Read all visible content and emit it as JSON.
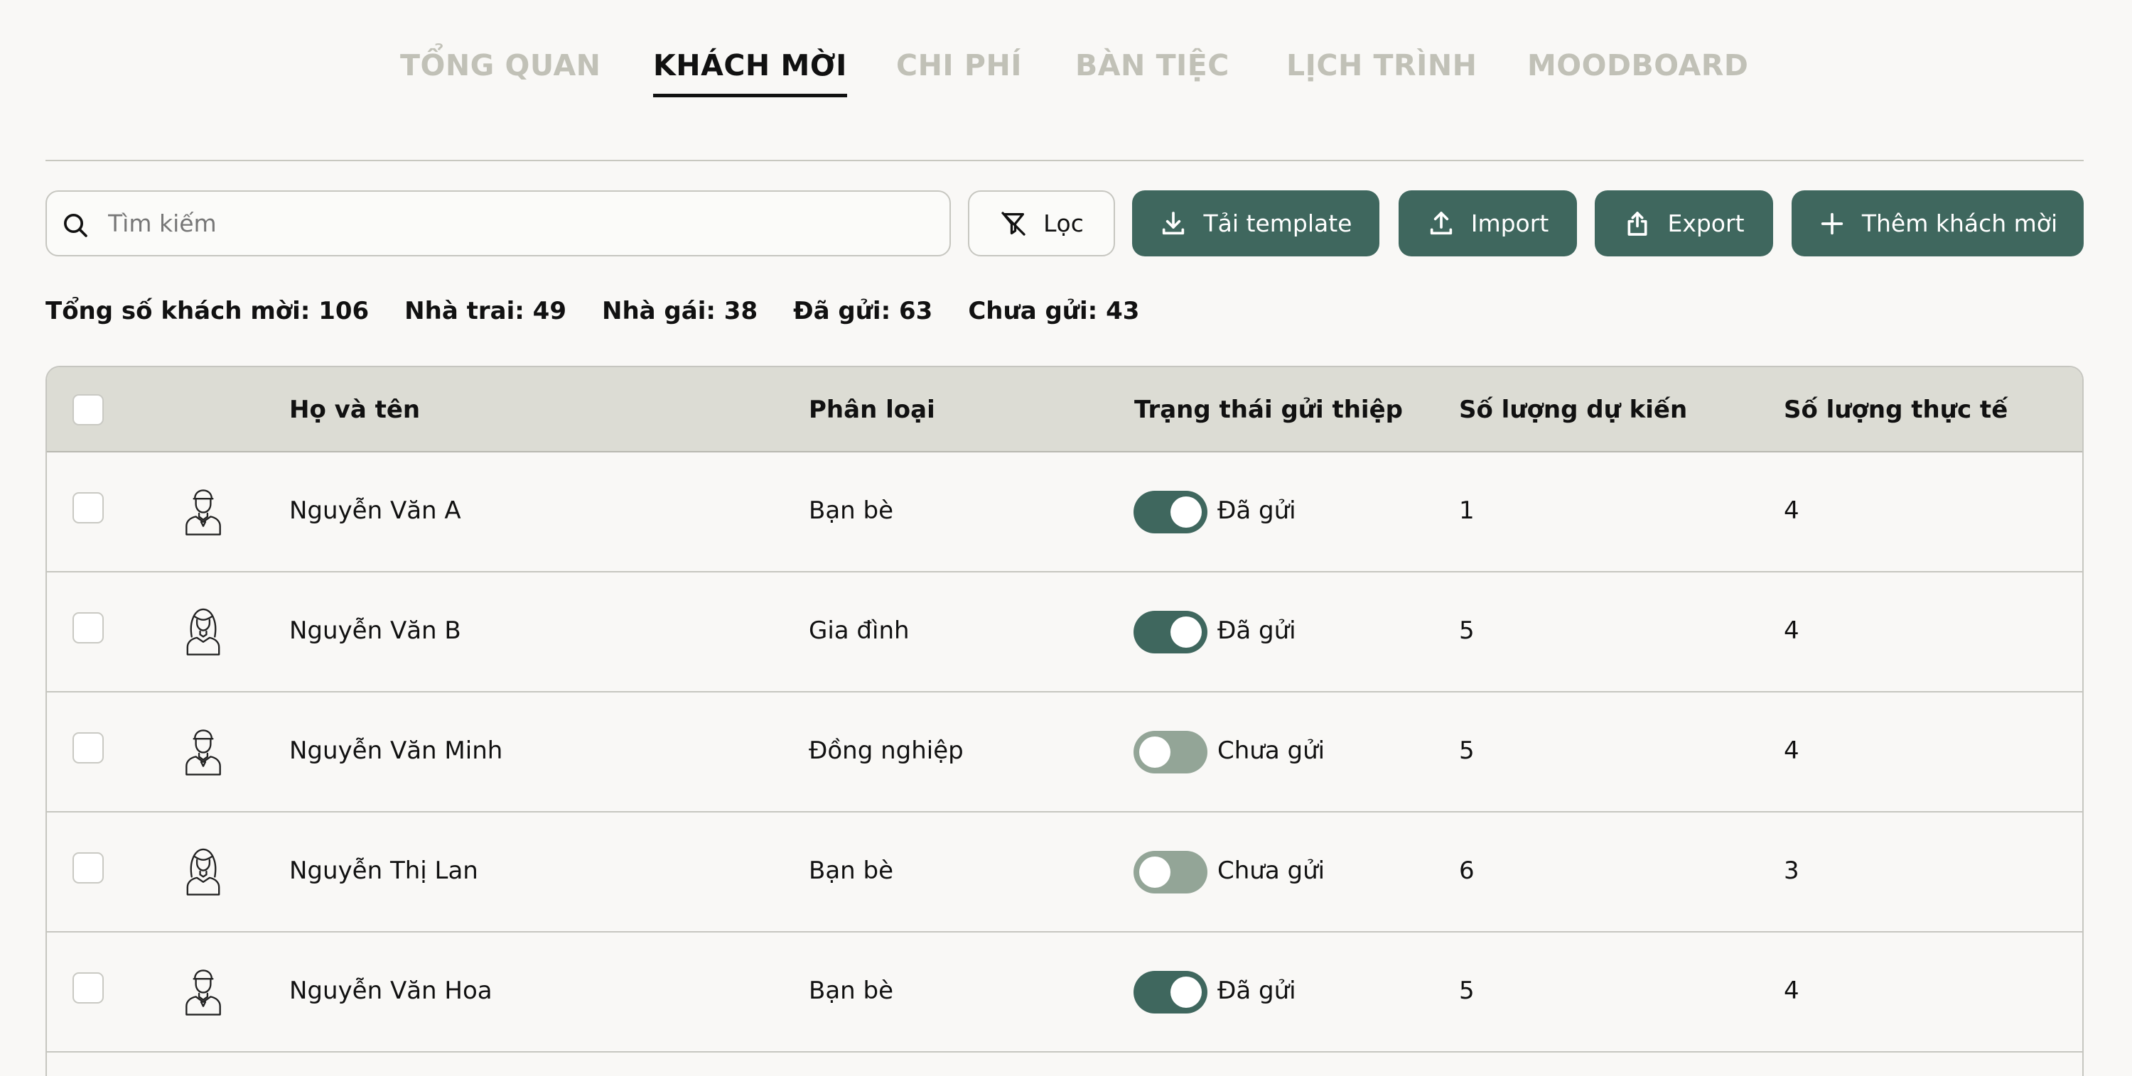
{
  "tabs": [
    {
      "label": "TỔNG QUAN",
      "active": false
    },
    {
      "label": "KHÁCH MỜI",
      "active": true
    },
    {
      "label": "CHI PHÍ",
      "active": false
    },
    {
      "label": "BÀN TIỆC",
      "active": false
    },
    {
      "label": "LỊCH TRÌNH",
      "active": false
    },
    {
      "label": "MOODBOARD",
      "active": false
    }
  ],
  "toolbar": {
    "search_placeholder": "Tìm kiếm",
    "filter_label": "Lọc",
    "download_template_label": "Tải template",
    "import_label": "Import",
    "export_label": "Export",
    "add_guest_label": "Thêm khách mời"
  },
  "stats": {
    "total": "Tổng số khách mời: 106",
    "groom_side": "Nhà trai: 49",
    "bride_side": "Nhà gái: 38",
    "sent": "Đã gửi: 63",
    "not_sent": "Chưa gửi: 43"
  },
  "table": {
    "headers": {
      "name": "Họ và tên",
      "category": "Phân loại",
      "invite_status": "Trạng thái gửi thiệp",
      "expected_count": "Số lượng dự kiến",
      "actual_count": "Số lượng thực tế"
    },
    "rows": [
      {
        "avatar": "groom-avatar-icon",
        "name": "Nguyễn Văn A",
        "category": "Bạn bè",
        "sent": true,
        "status": "Đã gửi",
        "expected": "1",
        "actual": "4"
      },
      {
        "avatar": "bride-avatar-icon",
        "name": "Nguyễn Văn B",
        "category": "Gia đình",
        "sent": true,
        "status": "Đã gửi",
        "expected": "5",
        "actual": "4"
      },
      {
        "avatar": "groom-avatar-icon",
        "name": "Nguyễn Văn Minh",
        "category": "Đồng nghiệp",
        "sent": false,
        "status": "Chưa gửi",
        "expected": "5",
        "actual": "4"
      },
      {
        "avatar": "bride-avatar-icon",
        "name": "Nguyễn Thị Lan",
        "category": "Bạn bè",
        "sent": false,
        "status": "Chưa gửi",
        "expected": "6",
        "actual": "3"
      },
      {
        "avatar": "groom-avatar-icon",
        "name": "Nguyễn Văn Hoa",
        "category": "Bạn bè",
        "sent": true,
        "status": "Đã gửi",
        "expected": "5",
        "actual": "4"
      }
    ]
  },
  "colors": {
    "accent": "#3f675e",
    "toggle_off": "#93a597",
    "inactive_tab": "#c1c1b7",
    "table_header_bg": "#dcdcd4",
    "page_bg": "#f9f8f6"
  }
}
